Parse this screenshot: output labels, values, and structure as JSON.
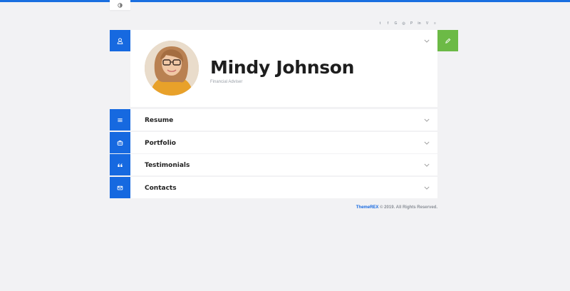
{
  "theme_toggle": {
    "icon": "contrast-icon"
  },
  "socials": [
    {
      "name": "twitter-icon",
      "glyph": "t"
    },
    {
      "name": "facebook-icon",
      "glyph": "f"
    },
    {
      "name": "google-icon",
      "glyph": "G"
    },
    {
      "name": "instagram-icon",
      "glyph": "◎"
    },
    {
      "name": "pinterest-icon",
      "glyph": "P"
    },
    {
      "name": "linkedin-icon",
      "glyph": "in"
    },
    {
      "name": "vimeo-icon",
      "glyph": "V"
    },
    {
      "name": "stack-icon",
      "glyph": "≡"
    }
  ],
  "profile": {
    "name": "Mindy Johnson",
    "role": "Financial Adviser"
  },
  "sections": [
    {
      "title": "Resume",
      "icon": "list-icon"
    },
    {
      "title": "Portfolio",
      "icon": "briefcase-icon"
    },
    {
      "title": "Testimonials",
      "icon": "quote-icon"
    },
    {
      "title": "Contacts",
      "icon": "envelope-icon"
    }
  ],
  "footer": {
    "brand": "ThemeREX",
    "text": " © 2019. All Rights Reserved."
  },
  "colors": {
    "primary": "#1669e0",
    "edit": "#6cba46",
    "background": "#f2f2f4"
  }
}
